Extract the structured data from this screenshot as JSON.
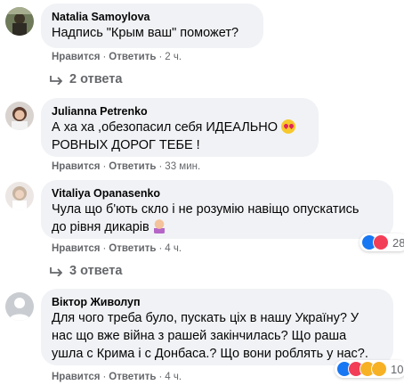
{
  "comments": [
    {
      "author": "Natalia Samoylova",
      "text": "Надпись \"Крым ваш\" поможет?",
      "like": "Нравится",
      "reply": "Ответить",
      "time": "2 ч.",
      "replies": "2 ответа"
    },
    {
      "author": "Julianna Petrenko",
      "text_line1": "А ха ха ,обезопасил себя ИДЕАЛЬНО",
      "text_line2": "РОВНЫХ ДОРОГ ТЕБЕ !",
      "like": "Нравится",
      "reply": "Ответить",
      "time": "33 мин."
    },
    {
      "author": "Vitaliya Opanasenko",
      "text_line1": "Чула що б'ють скло і не розумію навіщо опускатись",
      "text_line2": "до рівня дикарів",
      "like": "Нравится",
      "reply": "Ответить",
      "time": "4 ч.",
      "reaction_count": "28",
      "replies": "3 ответа"
    },
    {
      "author": "Віктор Живолуп",
      "text_line1": "Для чого треба було, пускать ціх в нашу Україну? У",
      "text_line2": "нас що вже війна з рашей закінчилась? Що раша",
      "text_line3": "ушла с Крима і с Донбаса.? Що вони роблять у нас?.",
      "like": "Нравится",
      "reply": "Ответить",
      "time": "4 ч.",
      "reaction_count": "10"
    }
  ],
  "colors": {
    "bubble": "#f0f2f5",
    "meta": "#65676b",
    "like_blue": "#1877f2",
    "love_red": "#f33e58",
    "haha_yellow": "#f7b125"
  },
  "icons": [
    "reply-arrow-icon",
    "like-reaction-icon",
    "love-reaction-icon",
    "haha-reaction-icon",
    "sad-reaction-icon",
    "heart-eyes-emoji-icon",
    "facepalm-emoji-icon"
  ]
}
